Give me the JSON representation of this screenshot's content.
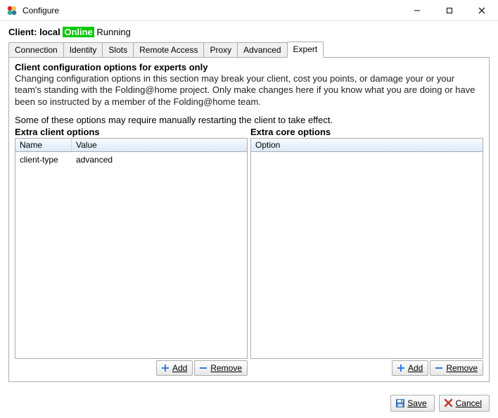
{
  "window": {
    "title": "Configure"
  },
  "status": {
    "label": "Client:",
    "name": "local",
    "online": "Online",
    "running": "Running"
  },
  "tabs": [
    {
      "label": "Connection"
    },
    {
      "label": "Identity"
    },
    {
      "label": "Slots"
    },
    {
      "label": "Remote Access"
    },
    {
      "label": "Proxy"
    },
    {
      "label": "Advanced"
    },
    {
      "label": "Expert"
    }
  ],
  "active_tab": 6,
  "expert": {
    "heading": "Client configuration options for experts only",
    "desc": "Changing configuration options in this section may break your client, cost you points, or damage your or your team's standing with the Folding@home project.  Only make changes here if you know what you are doing or have been so instructed by a member of the Folding@home team.",
    "note": "Some of these options may require manually restarting the client to take effect.",
    "client_panel": {
      "title": "Extra client options",
      "columns": {
        "name": "Name",
        "value": "Value"
      },
      "rows": [
        {
          "name": "client-type",
          "value": "advanced"
        }
      ]
    },
    "core_panel": {
      "title": "Extra core options",
      "columns": {
        "option": "Option"
      },
      "rows": []
    },
    "buttons": {
      "add": "Add",
      "remove": "Remove"
    }
  },
  "footer": {
    "save": "Save",
    "cancel": "Cancel"
  }
}
